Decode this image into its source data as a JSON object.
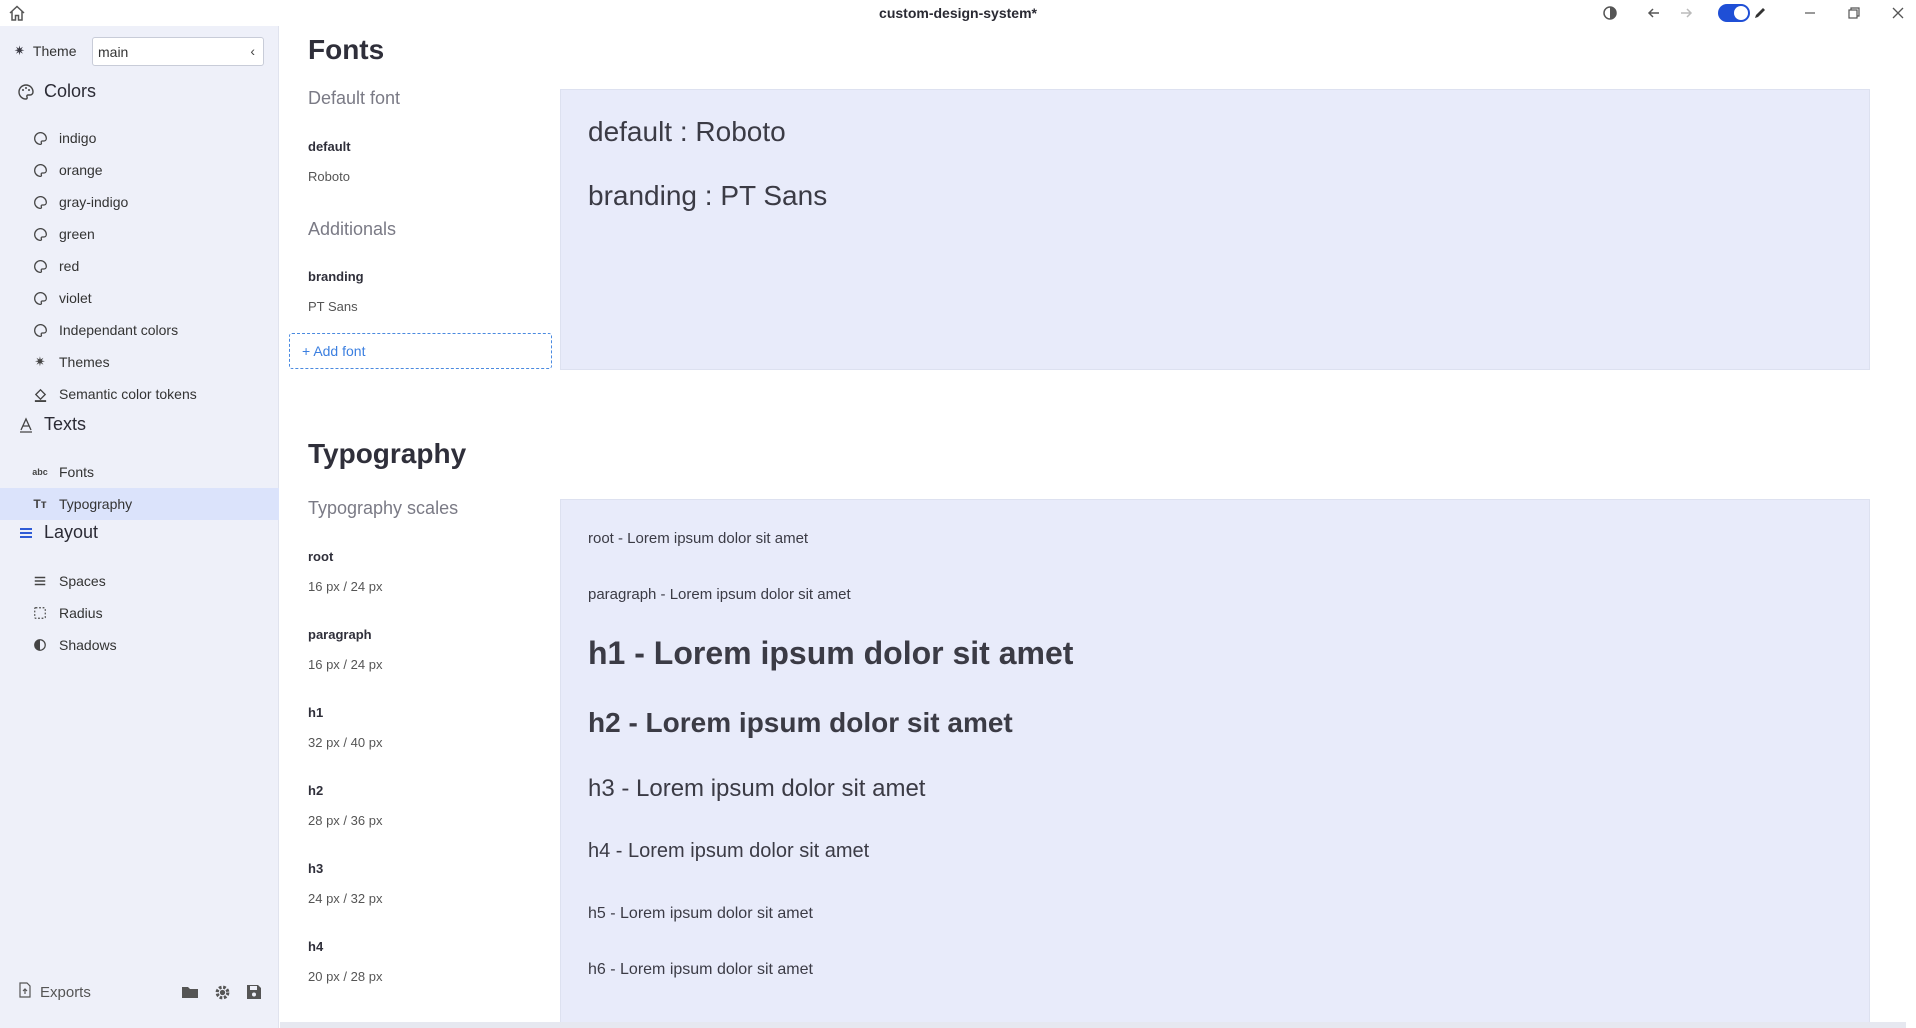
{
  "window": {
    "title": "custom-design-system*"
  },
  "sidebar": {
    "theme_label": "Theme",
    "theme_value": "main",
    "colors_title": "Colors",
    "colors": [
      "indigo",
      "orange",
      "gray-indigo",
      "green",
      "red",
      "violet",
      "Independant colors",
      "Themes",
      "Semantic color tokens"
    ],
    "texts_title": "Texts",
    "texts": [
      "Fonts",
      "Typography"
    ],
    "layout_title": "Layout",
    "layout": [
      "Spaces",
      "Radius",
      "Shadows"
    ],
    "exports_label": "Exports"
  },
  "fonts": {
    "title": "Fonts",
    "default_heading": "Default font",
    "default_key": "default",
    "default_value": "Roboto",
    "additionals_heading": "Additionals",
    "branding_key": "branding",
    "branding_value": "PT Sans",
    "add_font_label": "Add font",
    "preview": [
      "default : Roboto",
      "branding : PT Sans"
    ]
  },
  "typography": {
    "title": "Typography",
    "scales_heading": "Typography scales",
    "scales": [
      {
        "name": "root",
        "value": "16 px / 24 px"
      },
      {
        "name": "paragraph",
        "value": "16 px / 24 px"
      },
      {
        "name": "h1",
        "value": "32 px / 40 px"
      },
      {
        "name": "h2",
        "value": "28 px / 36 px"
      },
      {
        "name": "h3",
        "value": "24 px / 32 px"
      },
      {
        "name": "h4",
        "value": "20 px / 28 px"
      }
    ],
    "preview": [
      "root - Lorem ipsum dolor sit amet",
      "paragraph - Lorem ipsum dolor sit amet",
      "h1 - Lorem ipsum dolor sit amet",
      "h2 - Lorem ipsum dolor sit amet",
      "h3 - Lorem ipsum dolor sit amet",
      "h4 - Lorem ipsum dolor sit amet",
      "h5 - Lorem ipsum dolor sit amet",
      "h6 - Lorem ipsum dolor sit amet"
    ]
  },
  "icons": {
    "home": "home-icon",
    "contrast": "contrast-icon",
    "back": "arrow-left-icon",
    "forward": "arrow-right-icon",
    "pencil": "pencil-icon",
    "minimize": "minimize-icon",
    "maximize": "restore-icon",
    "close": "close-icon",
    "folder": "folder-icon",
    "settings": "gear-icon",
    "save": "save-icon"
  },
  "colors": {
    "accent": "#1f4fd6",
    "sidebar_bg": "#eef0f9",
    "active_item_bg": "#dbe3fb",
    "preview_bg": "#e8ebfa",
    "link_blue": "#3b7fe0"
  }
}
